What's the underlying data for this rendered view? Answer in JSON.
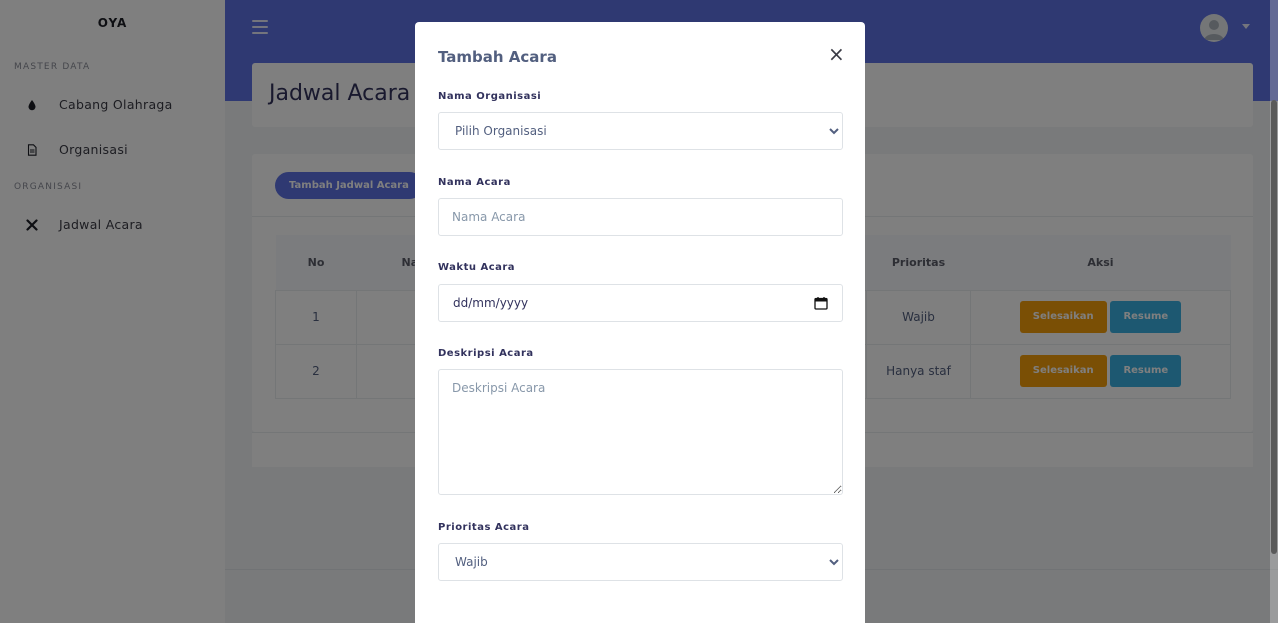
{
  "sidebar": {
    "brand": "OYA",
    "headings": [
      "MASTER DATA",
      "ORGANISASI"
    ],
    "items": [
      {
        "label": "Cabang Olahraga",
        "icon": "droplet-icon"
      },
      {
        "label": "Organisasi",
        "icon": "document-icon"
      },
      {
        "label": "Jadwal Acara",
        "icon": "tools-icon"
      }
    ]
  },
  "colors": {
    "primary": "#5e72e4",
    "warning": "#f59e0b",
    "info": "#3ab0e2"
  },
  "main": {
    "page_title": "Jadwal Acara",
    "add_button": "Tambah Jadwal Acara",
    "table": {
      "headers": [
        "No",
        "Na",
        "Prioritas",
        "Aksi"
      ],
      "rows": [
        {
          "no": "1",
          "prioritas": "Wajib",
          "finish": "Selesaikan",
          "resume": "Resume"
        },
        {
          "no": "2",
          "prioritas": "Hanya staf",
          "finish": "Selesaikan",
          "resume": "Resume"
        }
      ]
    }
  },
  "modal": {
    "title": "Tambah Acara",
    "close": "×",
    "fields": {
      "organisasi": {
        "label": "Nama Organisasi",
        "value": "Pilih Organisasi"
      },
      "nama": {
        "label": "Nama Acara",
        "placeholder": "Nama Acara"
      },
      "waktu": {
        "label": "Waktu Acara",
        "value": "dd/mm/yyyy"
      },
      "deskripsi": {
        "label": "Deskripsi Acara",
        "placeholder": "Deskripsi Acara"
      },
      "prioritas": {
        "label": "Prioritas Acara",
        "value": "Wajib"
      }
    }
  }
}
